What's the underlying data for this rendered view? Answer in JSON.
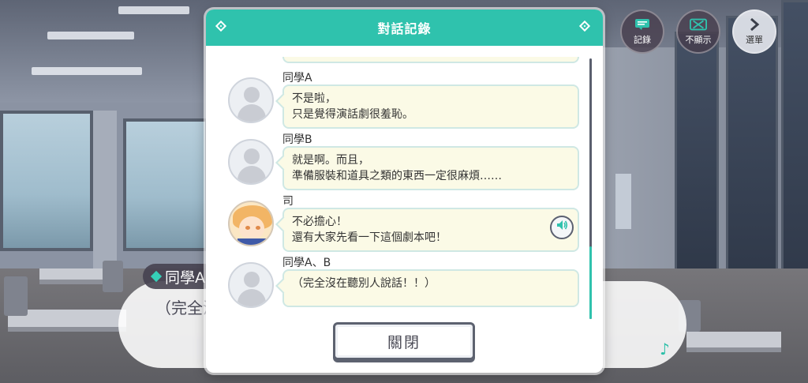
{
  "hud": {
    "log_label": "記錄",
    "hide_label": "不顯示",
    "menu_label": "選單"
  },
  "background_dialogue": {
    "speaker": "同學A",
    "text": "（完全沒"
  },
  "modal": {
    "title": "對話記錄",
    "close_label": "關閉",
    "entries": [
      {
        "speaker": "同學A",
        "lines": [
          "不是啦，",
          "只是覺得演話劇很羞恥。"
        ],
        "has_voice": false
      },
      {
        "speaker": "同學B",
        "lines": [
          "就是啊。而且，",
          "準備服裝和道具之類的東西一定很麻煩……"
        ],
        "has_voice": false
      },
      {
        "speaker": "司",
        "lines": [
          "不必擔心！",
          "還有大家先看一下這個劇本吧！"
        ],
        "has_voice": true
      },
      {
        "speaker": "同學A、B",
        "lines": [
          "（完全沒在聽別人說話！！）"
        ],
        "has_voice": false
      }
    ]
  },
  "colors": {
    "accent": "#2fc2ad",
    "bubble_bg": "#fbfae6",
    "bubble_border": "#cfe8e4"
  }
}
